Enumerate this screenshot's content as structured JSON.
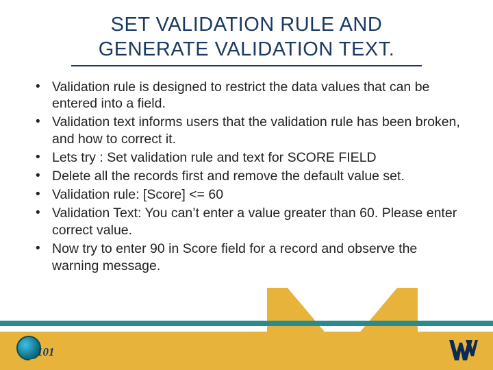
{
  "title_line1": "SET VALIDATION RULE AND",
  "title_line2": "GENERATE VALIDATION TEXT.",
  "bullets": [
    "Validation rule is designed to restrict the data values that can be entered into a field.",
    "Validation text informs users that the validation rule has been broken, and how to correct it.",
    "Lets try : Set validation rule and text for SCORE FIELD",
    "Delete all the records first and remove the default value set.",
    "Validation rule: [Score] <= 60",
    "Validation Text: You can’t enter a value greater than 60. Please enter correct value.",
    "Now try to enter 90 in Score field for a record and observe the warning message."
  ],
  "logo101_text": "101",
  "colors": {
    "title": "#1b3a63",
    "teal": "#2a8a8e",
    "gold": "#e8b33a",
    "wv_navy": "#0b2b52"
  }
}
